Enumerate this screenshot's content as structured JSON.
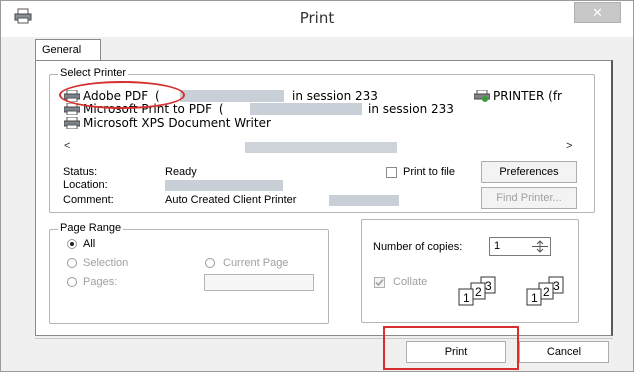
{
  "window": {
    "title": "Print",
    "close_glyph": "✕"
  },
  "tabs": [
    {
      "label": "General"
    }
  ],
  "select_printer": {
    "group_label": "Select Printer",
    "printers": [
      {
        "name": "Adobe PDF",
        "prefix": "(",
        "session": "in session 233",
        "icon": "printer-icon"
      },
      {
        "name": "Microsoft Print to PDF",
        "prefix": "(",
        "session": "in session 233",
        "icon": "printer-icon"
      },
      {
        "name": "Microsoft XPS Document Writer",
        "icon": "printer-icon"
      },
      {
        "name": "PRINTER (fr",
        "icon": "network-printer-icon"
      }
    ],
    "scroll_left": "<",
    "scroll_right": ">",
    "status_label": "Status:",
    "status_value": "Ready",
    "location_label": "Location:",
    "comment_label": "Comment:",
    "comment_value": "Auto Created Client Printer",
    "print_to_file": "Print to file",
    "preferences": "Preferences",
    "find_printer": "Find Printer..."
  },
  "page_range": {
    "group_label": "Page Range",
    "options": [
      {
        "label": "All",
        "selected": true
      },
      {
        "label": "Selection",
        "selected": false
      },
      {
        "label": "Current Page",
        "selected": false
      },
      {
        "label": "Pages:",
        "selected": false
      }
    ]
  },
  "copies": {
    "label": "Number of copies:",
    "value": "1",
    "collate_label": "Collate",
    "collate_checked": true
  },
  "actions": {
    "print": "Print",
    "cancel": "Cancel"
  },
  "colors": {
    "highlight": "#d62f2f",
    "redacted": "#c9cfd6"
  }
}
